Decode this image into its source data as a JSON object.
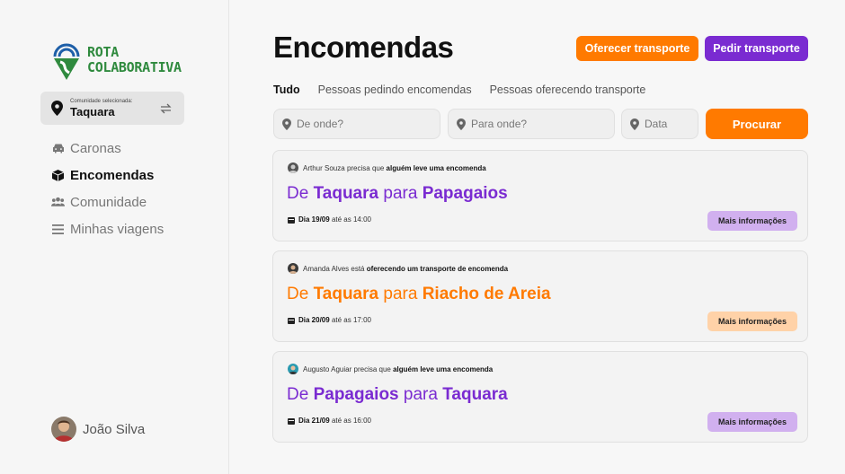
{
  "brand": {
    "line1": "ROTA",
    "line2": "COLABORATIVA"
  },
  "community": {
    "label": "Comunidade selecionada:",
    "value": "Taquara"
  },
  "nav": [
    {
      "label": "Caronas",
      "icon": "car-icon",
      "active": false
    },
    {
      "label": "Encomendas",
      "icon": "package-icon",
      "active": true
    },
    {
      "label": "Comunidade",
      "icon": "users-icon",
      "active": false
    },
    {
      "label": "Minhas viagens",
      "icon": "list-icon",
      "active": false
    }
  ],
  "user": {
    "name": "João Silva"
  },
  "page": {
    "title": "Encomendas"
  },
  "actions": {
    "offer": "Oferecer transporte",
    "request": "Pedir transporte"
  },
  "tabs": [
    "Tudo",
    "Pessoas pedindo encomendas",
    "Pessoas oferecendo transporte"
  ],
  "search": {
    "from": "De onde?",
    "to": "Para onde?",
    "date": "Data",
    "button": "Procurar"
  },
  "cards": [
    {
      "user": "Arthur Souza",
      "verb": "precisa que",
      "action": "alguém leve uma encomenda",
      "from_word": "De",
      "from": "Taquara",
      "to_word": "para",
      "to": "Papagaios",
      "date": "Dia 19/09",
      "time": "até as 14:00",
      "button": "Mais informações"
    },
    {
      "user": "Amanda Alves",
      "verb": "está",
      "action": "oferecendo um transporte de encomenda",
      "from_word": "De",
      "from": "Taquara",
      "to_word": "para",
      "to": "Riacho de Areia",
      "date": "Dia 20/09",
      "time": "até as 17:00",
      "button": "Mais informações"
    },
    {
      "user": "Augusto Aguiar",
      "verb": "precisa que",
      "action": "alguém leve uma encomenda",
      "from_word": "De",
      "from": "Papagaios",
      "to_word": "para",
      "to": "Taquara",
      "date": "Dia 21/09",
      "time": "até as 16:00",
      "button": "Mais informações"
    }
  ],
  "colors": {
    "orange": "#ff7a00",
    "purple": "#7a2bd1",
    "green": "#2f8a3e"
  }
}
